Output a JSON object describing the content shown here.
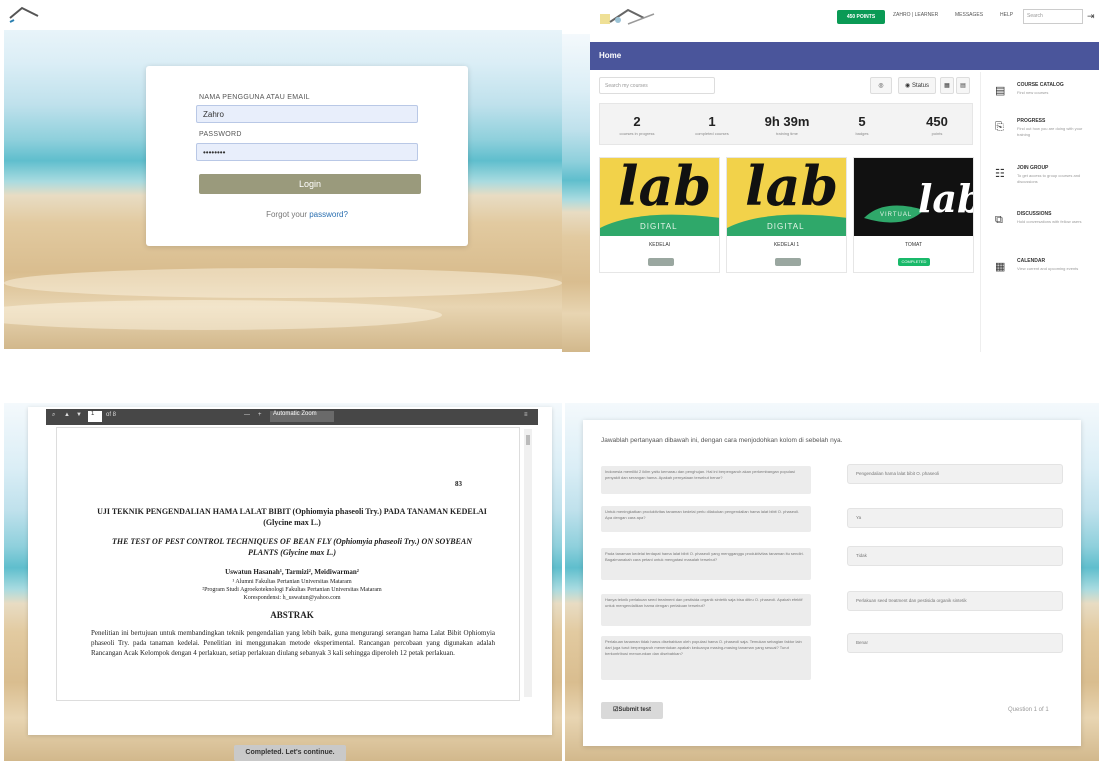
{
  "login": {
    "username_label": "NAMA PENGGUNA ATAU EMAIL",
    "username_value": "Zahro",
    "password_label": "PASSWORD",
    "password_value": "••••••••",
    "login_button": "Login",
    "forgot_prefix": "Forgot your ",
    "forgot_link": "password?"
  },
  "dashboard": {
    "nav": {
      "points_button": "450 POINTS",
      "user": "ZAHRO | LEARNER",
      "messages": "MESSAGES",
      "help": "HELP",
      "search_placeholder": "Search"
    },
    "home_title": "Home",
    "course_search_placeholder": "Search my courses",
    "status_button": "Status",
    "stats": [
      {
        "value": "2",
        "label": "courses in progress"
      },
      {
        "value": "1",
        "label": "completed courses"
      },
      {
        "value": "9h 39m",
        "label": "training time"
      },
      {
        "value": "5",
        "label": "badges"
      },
      {
        "value": "450",
        "label": "points"
      }
    ],
    "courses": [
      {
        "title": "KEDELAI",
        "chip": "",
        "chip_color": "#9aa7a0"
      },
      {
        "title": "KEDELAI 1",
        "chip": "",
        "chip_color": "#9aa7a0"
      },
      {
        "title": "TOMAT",
        "chip": "COMPLETED",
        "chip_color": "#19b96a"
      }
    ],
    "lab_word": "lab",
    "digital_word": "DIGITAL",
    "virtual_word": "VIRTUAL",
    "sidebar": [
      {
        "title": "COURSE CATALOG",
        "desc": "Find new courses",
        "icon": "catalog-icon",
        "glyph": "▤"
      },
      {
        "title": "PROGRESS",
        "desc": "Find out how you are doing with your training",
        "icon": "progress-icon",
        "glyph": "⎘"
      },
      {
        "title": "JOIN GROUP",
        "desc": "To get access to group courses and discussions",
        "icon": "group-icon",
        "glyph": "☷"
      },
      {
        "title": "DISCUSSIONS",
        "desc": "Hold conversations with fellow users",
        "icon": "discussion-icon",
        "glyph": "⧉"
      },
      {
        "title": "CALENDAR",
        "desc": "View current and upcoming events",
        "icon": "calendar-icon",
        "glyph": "▦"
      }
    ]
  },
  "pdf": {
    "page_field": "1",
    "page_total": "of 8",
    "zoom": "Automatic Zoom",
    "page_number": "83",
    "title_id": "UJI TEKNIK PENGENDALIAN HAMA LALAT BIBIT (Ophiomyia phaseoli Try.) PADA TANAMAN KEDELAI (Glycine max L.)",
    "title_en": "THE TEST OF PEST CONTROL TECHNIQUES OF BEAN FLY (Ophiomyia phaseoli Try.) ON SOYBEAN PLANTS (Glycine max L.)",
    "authors": "Uswatun Hasanah¹, Tarmizi², Meidiwarman²",
    "affil1": "¹ Alumni Fakultas Pertanian Universitas Mataram",
    "affil2": "²Program Studi Agroekoteknologi Fakultas Pertanian Universitas Mataram",
    "corresp": "Korespondensi: h_uswatun@yahoo.com",
    "abstract_heading": "ABSTRAK",
    "abstract_text": "Penelitian ini bertujuan untuk membandingkan teknik pengendalian yang lebih baik, guna mengurangi serangan hama Lalat Bibit Ophiomyia phaseoli Try. pada tanaman kedelai. Penelitian ini menggunakan metode eksperimental. Rancangan percobaan yang digunakan adalah Rancangan Acak Kelompok dengan 4 perlakuan, setiap perlakuan diulang sebanyak 3 kali sehingga diperoleh 12 petak perlakuan.",
    "continue_button": "Completed. Let's continue."
  },
  "quiz": {
    "instruction": "Jawablah pertanyaan dibawah ini, dengan cara menjodohkan kolom di sebelah nya.",
    "questions": [
      "Indonesia memiliki 2 iklim yaitu kemarau dan penghujan. Hal ini berpengaruh akan perkembangan populasi penyakit dan serangan hama. Apakah pernyataan tersebut benar?",
      "Untuk meningkatkan produktivitas tanaman kedelai perlu dilakukan pengendalian hama lalat bibit O. phaseoli. Apa dengan cara apa?",
      "Pada tanaman kedelai terdapat hama lalat bibit O. phaseoli yang mengganggu produktivitas tanaman itu sendiri. Bagaimanakah cara petani untuk mengatasi masalah tersebut?",
      "Hanya teknik perlakuan seed treatment dan pestisida organik sintetik saja bisa ditiru O. phaseoli. Apakah efektif untuk mengendalikan hama dengan perlakuan tersebut?",
      "Perlakuan tanaman tidak harus disebabkan oleh populasi hama O. phaseoli saja. Temukan sebagian faktor lain dari juga turut berpengaruh menentukan apakah keduanya masing-masing tanaman yang sesuai? Turut berkontribusi menurunkan dan disebabkan?"
    ],
    "answers": [
      "Pengendalian hama lalat bibit O. phaseoli",
      "Ya",
      "Tidak",
      "Perlakuan seed treatment dan pestisida organik sintetik",
      "Benar"
    ],
    "submit_button": "Submit test",
    "question_counter": "Question 1 of 1"
  }
}
